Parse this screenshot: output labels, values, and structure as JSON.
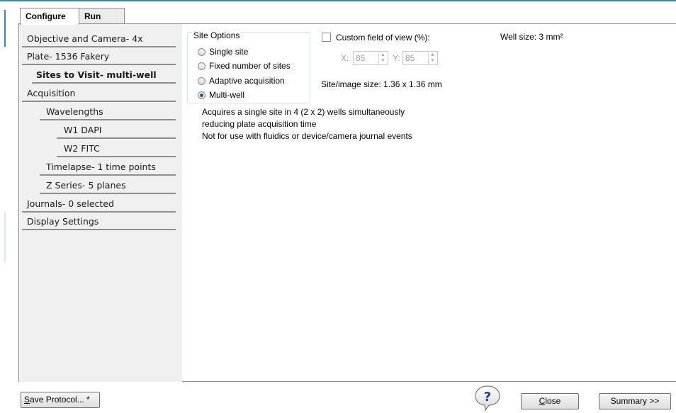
{
  "window": {
    "accent_color": "#2f8fa8"
  },
  "tabs": [
    {
      "label": "Configure",
      "active": true
    },
    {
      "label": "Run",
      "active": false
    }
  ],
  "nav": {
    "items": [
      {
        "label": "Objective and Camera- 4x"
      },
      {
        "label": "Plate- 1536 Fakery"
      },
      {
        "label": "Sites to Visit- multi-well",
        "selected": true
      },
      {
        "label": "Acquisition"
      },
      {
        "label": "Wavelengths"
      },
      {
        "label": "W1 DAPI"
      },
      {
        "label": "W2 FITC"
      },
      {
        "label": "Timelapse- 1 time points"
      },
      {
        "label": "Z Series- 5 planes"
      },
      {
        "label": "Journals- 0 selected"
      },
      {
        "label": "Display Settings"
      }
    ]
  },
  "site_options": {
    "group_label": "Site Options",
    "options": [
      {
        "label": "Single site",
        "checked": false
      },
      {
        "label": "Fixed number of sites",
        "checked": false
      },
      {
        "label": "Adaptive acquisition",
        "checked": false
      },
      {
        "label": "Multi-well",
        "checked": true
      }
    ],
    "description": [
      "Acquires a single site in 4 (2 x 2) wells simultaneously",
      "reducing plate acquisition time",
      "Not for use with fluidics or device/camera journal events"
    ]
  },
  "custom_fov": {
    "label": "Custom field of view (%):",
    "checked": false,
    "x_label": "X:",
    "x_value": "85",
    "y_label": "Y:",
    "y_value": "85"
  },
  "site_image_size": "Site/image size: 1.36 x 1.36 mm",
  "well_size": "Well size: 3 mm²",
  "footer": {
    "save_label_prefix": "S",
    "save_label_rest": "ave Protocol... *",
    "help_icon": "question-bubble-icon",
    "close_label_prefix": "C",
    "close_label_rest": "lose",
    "summary_label": "Summary >>"
  }
}
